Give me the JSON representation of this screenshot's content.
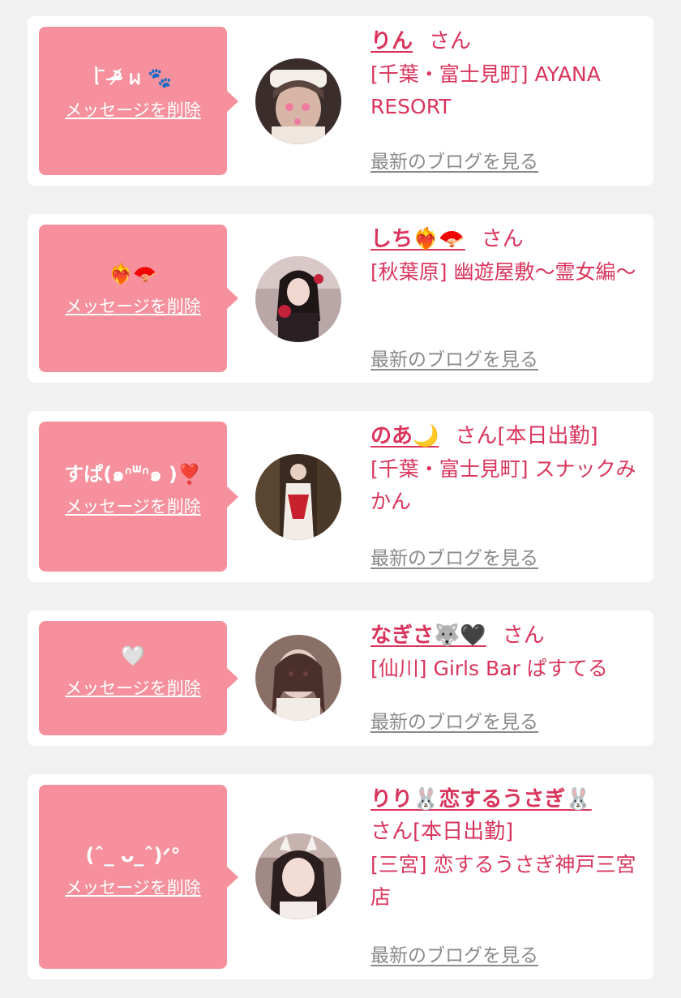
{
  "common": {
    "delete_label": "メッセージを削除",
    "blog_label": "最新のブログを見る"
  },
  "colors": {
    "accent": "#d9355c",
    "bubble": "#f5909c",
    "link_gray": "#8a8a8a",
    "background": "#f1f1f1"
  },
  "entries": [
    {
      "message": "ᥣ ̄ ᵒ̴̶̷᷄ ᥕ 🐾",
      "name": "りん",
      "san": "さん",
      "shop": "[千葉・富士見町] AYANA RESORT",
      "avatar_icon": "avatar-photo-icon"
    },
    {
      "message": "❤️‍🔥🪭",
      "name": "しち❤️‍🔥🪭",
      "san": "さん",
      "shop": "[秋葉原] 幽遊屋敷〜霊女編〜",
      "avatar_icon": "avatar-photo-icon"
    },
    {
      "message": "すぱ(๑ᐢᐜᐢ๑ )❣️",
      "name": "のあ🌙",
      "san": "さん[本日出勤]",
      "shop": "[千葉・富士見町] スナックみかん",
      "avatar_icon": "avatar-photo-icon"
    },
    {
      "message": "🤍",
      "name": "なぎさ🐺🖤",
      "san": "さん",
      "shop": "[仙川] Girls Bar ぱすてる",
      "avatar_icon": "avatar-photo-icon"
    },
    {
      "message": "(ˆ_ ᴗ_ˆ)ᐟ°",
      "name": "りり🐰恋するうさぎ🐰",
      "san": "さん[本日出勤]",
      "shop": "[三宮] 恋するうさぎ神戸三宮店",
      "avatar_icon": "avatar-photo-icon"
    }
  ]
}
